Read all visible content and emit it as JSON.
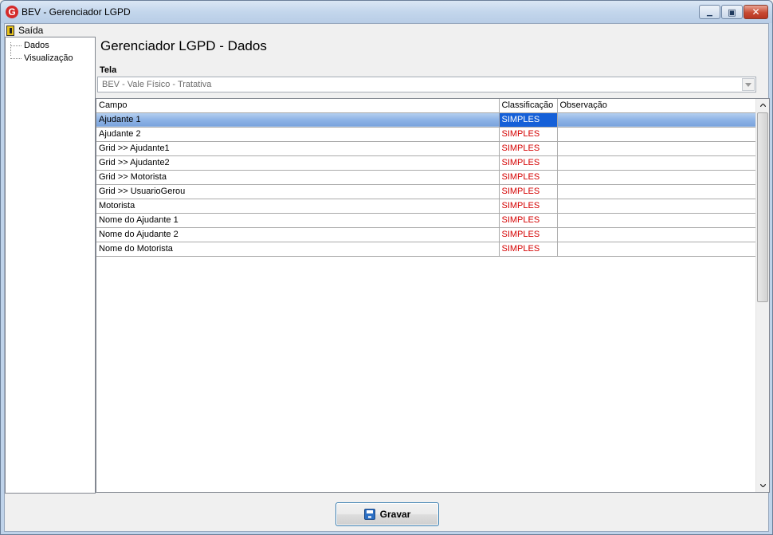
{
  "window": {
    "title": "BEV - Gerenciador LGPD",
    "app_icon_letter": "G",
    "minimize_symbol": "▁",
    "maximize_symbol": "▣",
    "close_symbol": "✕"
  },
  "menu": {
    "items": [
      {
        "label": "Saída",
        "icon": "exit-door-icon"
      }
    ]
  },
  "sidebar": {
    "items": [
      {
        "label": "Dados"
      },
      {
        "label": "Visualização"
      }
    ]
  },
  "main": {
    "title": "Gerenciador LGPD - Dados",
    "tela_label": "Tela",
    "tela_value": "BEV - Vale Físico - Tratativa"
  },
  "grid": {
    "columns": [
      "Campo",
      "Classificação",
      "Observação"
    ],
    "rows": [
      {
        "campo": "Ajudante 1",
        "classificacao": "SIMPLES",
        "observacao": ""
      },
      {
        "campo": "Ajudante 2",
        "classificacao": "SIMPLES",
        "observacao": ""
      },
      {
        "campo": "Grid >> Ajudante1",
        "classificacao": "SIMPLES",
        "observacao": ""
      },
      {
        "campo": "Grid >> Ajudante2",
        "classificacao": "SIMPLES",
        "observacao": ""
      },
      {
        "campo": "Grid >> Motorista",
        "classificacao": "SIMPLES",
        "observacao": ""
      },
      {
        "campo": "Grid >> UsuarioGerou",
        "classificacao": "SIMPLES",
        "observacao": ""
      },
      {
        "campo": "Motorista",
        "classificacao": "SIMPLES",
        "observacao": ""
      },
      {
        "campo": "Nome do Ajudante 1",
        "classificacao": "SIMPLES",
        "observacao": ""
      },
      {
        "campo": "Nome do Ajudante 2",
        "classificacao": "SIMPLES",
        "observacao": ""
      },
      {
        "campo": "Nome do Motorista",
        "classificacao": "SIMPLES",
        "observacao": ""
      }
    ],
    "selected_row": 0,
    "classification_color": "#d40000"
  },
  "footer": {
    "save_label": "Gravar",
    "save_icon": "floppy-disk-icon"
  }
}
